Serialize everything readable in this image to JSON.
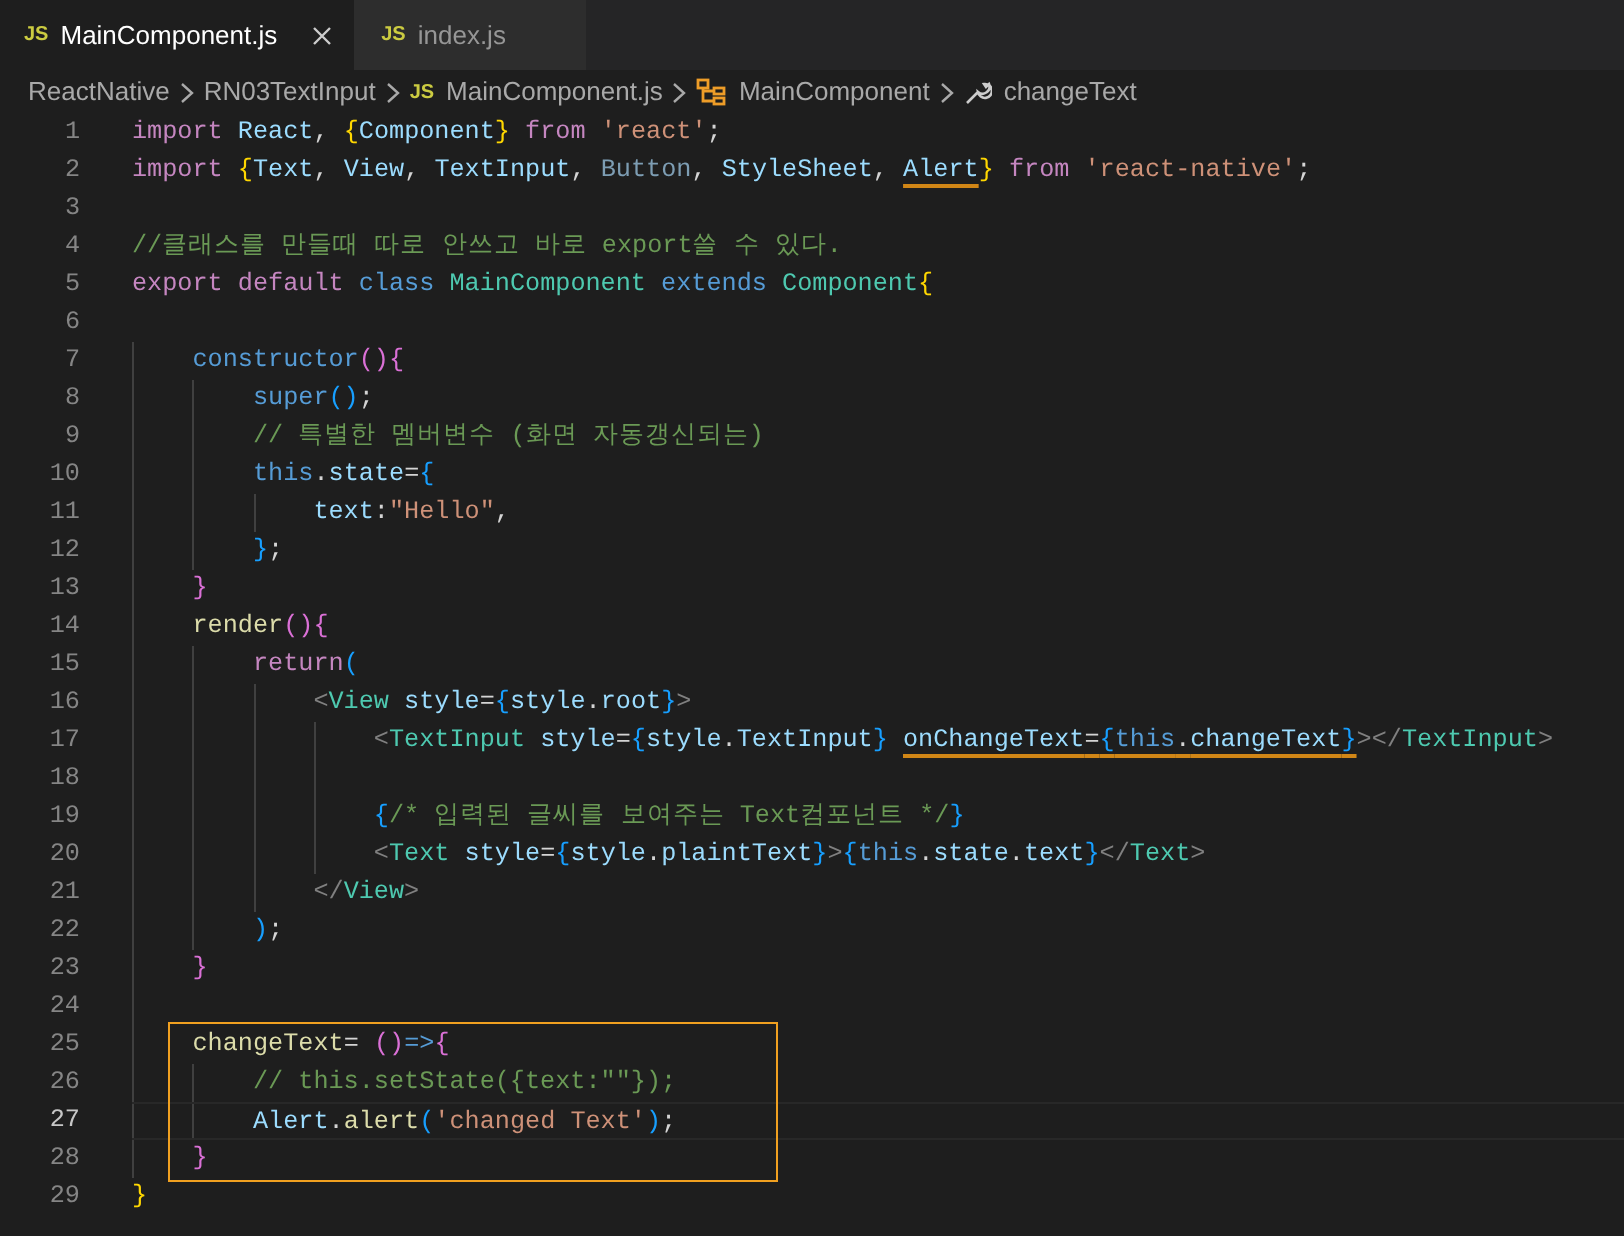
{
  "tabs": [
    {
      "badge": "JS",
      "label": "MainComponent.js",
      "selected": true
    },
    {
      "badge": "JS",
      "label": "index.js",
      "selected": false
    }
  ],
  "breadcrumb": [
    {
      "kind": "folder",
      "label": "ReactNative"
    },
    {
      "kind": "folder",
      "label": "RN03TextInput"
    },
    {
      "kind": "file",
      "badge": "JS",
      "label": "MainComponent.js"
    },
    {
      "kind": "class",
      "label": "MainComponent"
    },
    {
      "kind": "method",
      "label": "changeText"
    }
  ],
  "lines": [
    {
      "number": "1",
      "current": false,
      "boxed": false,
      "tokens": [
        {
          "kind": "kw",
          "t": "import "
        },
        {
          "kind": "var",
          "t": "React"
        },
        {
          "kind": "p",
          "t": ", "
        },
        {
          "kind": "b1",
          "t": "{"
        },
        {
          "kind": "var",
          "t": "Component"
        },
        {
          "kind": "b1",
          "t": "}"
        },
        {
          "kind": "kw",
          "t": " from "
        },
        {
          "kind": "str",
          "t": "'react'"
        },
        {
          "kind": "p",
          "t": ";"
        }
      ]
    },
    {
      "number": "2",
      "current": false,
      "boxed": false,
      "tokens": [
        {
          "kind": "kw",
          "t": "import "
        },
        {
          "kind": "b1",
          "t": "{"
        },
        {
          "kind": "var",
          "t": "Text"
        },
        {
          "kind": "p",
          "t": ", "
        },
        {
          "kind": "var",
          "t": "View"
        },
        {
          "kind": "p",
          "t": ", "
        },
        {
          "kind": "var",
          "t": "TextInput"
        },
        {
          "kind": "p",
          "t": ", "
        },
        {
          "kind": "unused",
          "t": "Button"
        },
        {
          "kind": "p",
          "t": ", "
        },
        {
          "kind": "var",
          "t": "StyleSheet"
        },
        {
          "kind": "p",
          "t": ", "
        },
        {
          "kind": "var_u",
          "t": "Alert"
        },
        {
          "kind": "b1",
          "t": "}"
        },
        {
          "kind": "kw",
          "t": " from "
        },
        {
          "kind": "str",
          "t": "'react-native'"
        },
        {
          "kind": "p",
          "t": ";"
        }
      ]
    },
    {
      "number": "3",
      "current": false,
      "boxed": false
    },
    {
      "number": "4",
      "current": false,
      "boxed": false,
      "tokens": [
        {
          "kind": "com",
          "t": "//클래스를 만들때 따로 안쓰고 바로 export쓸 수 있다."
        }
      ]
    },
    {
      "number": "5",
      "current": false,
      "boxed": false,
      "tokens": [
        {
          "kind": "kw",
          "t": "export default "
        },
        {
          "kind": "sto",
          "t": "class "
        },
        {
          "kind": "cls",
          "t": "MainComponent "
        },
        {
          "kind": "sto",
          "t": "extends "
        },
        {
          "kind": "cls",
          "t": "Component"
        },
        {
          "kind": "b1",
          "t": "{"
        }
      ]
    },
    {
      "number": "6",
      "current": false,
      "boxed": false
    },
    {
      "number": "7",
      "current": false,
      "boxed": false,
      "tokens": [
        {
          "kind": "sto",
          "t": "    constructor"
        },
        {
          "kind": "b2",
          "t": "(){"
        }
      ]
    },
    {
      "number": "8",
      "current": false,
      "boxed": false,
      "tokens": [
        {
          "kind": "sto",
          "t": "        super"
        },
        {
          "kind": "b3",
          "t": "()"
        },
        {
          "kind": "p",
          "t": ";"
        }
      ]
    },
    {
      "number": "9",
      "current": false,
      "boxed": false,
      "tokens": [
        {
          "kind": "com",
          "t": "        // 특별한 멤버변수 (화면 자동갱신되는)"
        }
      ]
    },
    {
      "number": "10",
      "current": false,
      "boxed": false,
      "tokens": [
        {
          "kind": "sto",
          "t": "        this"
        },
        {
          "kind": "p",
          "t": "."
        },
        {
          "kind": "var",
          "t": "state"
        },
        {
          "kind": "p",
          "t": "="
        },
        {
          "kind": "b3",
          "t": "{"
        }
      ]
    },
    {
      "number": "11",
      "current": false,
      "boxed": false,
      "tokens": [
        {
          "kind": "var",
          "t": "            text"
        },
        {
          "kind": "p",
          "t": ":"
        },
        {
          "kind": "str",
          "t": "\"Hello\""
        },
        {
          "kind": "p",
          "t": ","
        }
      ]
    },
    {
      "number": "12",
      "current": false,
      "boxed": false,
      "tokens": [
        {
          "kind": "b3",
          "t": "        }"
        },
        {
          "kind": "p",
          "t": ";"
        }
      ]
    },
    {
      "number": "13",
      "current": false,
      "boxed": false,
      "tokens": [
        {
          "kind": "b2",
          "t": "    }"
        }
      ]
    },
    {
      "number": "14",
      "current": false,
      "boxed": false,
      "tokens": [
        {
          "kind": "fn",
          "t": "    render"
        },
        {
          "kind": "b2",
          "t": "(){"
        }
      ]
    },
    {
      "number": "15",
      "current": false,
      "boxed": false,
      "tokens": [
        {
          "kind": "kw",
          "t": "        return"
        },
        {
          "kind": "b3",
          "t": "("
        }
      ]
    },
    {
      "number": "16",
      "current": false,
      "boxed": false,
      "tokens": [
        {
          "kind": "tag",
          "t": "            <"
        },
        {
          "kind": "cls",
          "t": "View "
        },
        {
          "kind": "var",
          "t": "style"
        },
        {
          "kind": "p",
          "t": "="
        },
        {
          "kind": "b3",
          "t": "{"
        },
        {
          "kind": "var",
          "t": "style"
        },
        {
          "kind": "p",
          "t": "."
        },
        {
          "kind": "var",
          "t": "root"
        },
        {
          "kind": "b3",
          "t": "}"
        },
        {
          "kind": "tag",
          "t": ">"
        }
      ]
    },
    {
      "number": "17",
      "current": false,
      "boxed": false,
      "tokens": [
        {
          "kind": "tag",
          "t": "                <"
        },
        {
          "kind": "cls",
          "t": "TextInput "
        },
        {
          "kind": "var",
          "t": "style"
        },
        {
          "kind": "p",
          "t": "="
        },
        {
          "kind": "b3",
          "t": "{"
        },
        {
          "kind": "var",
          "t": "style"
        },
        {
          "kind": "p",
          "t": "."
        },
        {
          "kind": "var",
          "t": "TextInput"
        },
        {
          "kind": "b3",
          "t": "} "
        },
        {
          "kind": "var_u",
          "t": "onChangeText"
        },
        {
          "kind": "p_u",
          "t": "="
        },
        {
          "kind": "b3_u",
          "t": "{"
        },
        {
          "kind": "sto_u",
          "t": "this"
        },
        {
          "kind": "p_u",
          "t": "."
        },
        {
          "kind": "var_u",
          "t": "changeText"
        },
        {
          "kind": "b3_u",
          "t": "}"
        },
        {
          "kind": "tag",
          "t": "></"
        },
        {
          "kind": "cls",
          "t": "TextInput"
        },
        {
          "kind": "tag",
          "t": ">"
        }
      ]
    },
    {
      "number": "18",
      "current": false,
      "boxed": false
    },
    {
      "number": "19",
      "current": false,
      "boxed": false,
      "tokens": [
        {
          "kind": "b3",
          "t": "                {"
        },
        {
          "kind": "com",
          "t": "/* 입력된 글씨를 보여주는 Text컴포넌트 */"
        },
        {
          "kind": "b3",
          "t": "}"
        }
      ]
    },
    {
      "number": "20",
      "current": false,
      "boxed": false,
      "tokens": [
        {
          "kind": "tag",
          "t": "                <"
        },
        {
          "kind": "cls",
          "t": "Text "
        },
        {
          "kind": "var",
          "t": "style"
        },
        {
          "kind": "p",
          "t": "="
        },
        {
          "kind": "b3",
          "t": "{"
        },
        {
          "kind": "var",
          "t": "style"
        },
        {
          "kind": "p",
          "t": "."
        },
        {
          "kind": "var",
          "t": "plaintText"
        },
        {
          "kind": "b3",
          "t": "}"
        },
        {
          "kind": "tag",
          "t": ">"
        },
        {
          "kind": "b3",
          "t": "{"
        },
        {
          "kind": "sto",
          "t": "this"
        },
        {
          "kind": "p",
          "t": "."
        },
        {
          "kind": "var",
          "t": "state"
        },
        {
          "kind": "p",
          "t": "."
        },
        {
          "kind": "var",
          "t": "text"
        },
        {
          "kind": "b3",
          "t": "}"
        },
        {
          "kind": "tag",
          "t": "</"
        },
        {
          "kind": "cls",
          "t": "Text"
        },
        {
          "kind": "tag",
          "t": ">"
        }
      ]
    },
    {
      "number": "21",
      "current": false,
      "boxed": false,
      "tokens": [
        {
          "kind": "tag",
          "t": "            </"
        },
        {
          "kind": "cls",
          "t": "View"
        },
        {
          "kind": "tag",
          "t": ">"
        }
      ]
    },
    {
      "number": "22",
      "current": false,
      "boxed": false,
      "tokens": [
        {
          "kind": "b3",
          "t": "        )"
        },
        {
          "kind": "p",
          "t": ";"
        }
      ]
    },
    {
      "number": "23",
      "current": false,
      "boxed": false,
      "tokens": [
        {
          "kind": "b2",
          "t": "    }"
        }
      ]
    },
    {
      "number": "24",
      "current": false,
      "boxed": false
    },
    {
      "number": "25",
      "current": false,
      "boxed": true,
      "tokens": [
        {
          "kind": "fn",
          "t": "    changeText"
        },
        {
          "kind": "p",
          "t": "= "
        },
        {
          "kind": "b2",
          "t": "()"
        },
        {
          "kind": "sto",
          "t": "=>"
        },
        {
          "kind": "b2",
          "t": "{"
        }
      ]
    },
    {
      "number": "26",
      "current": false,
      "boxed": true,
      "tokens": [
        {
          "kind": "com",
          "t": "        // this.setState({text:\"\"});"
        }
      ]
    },
    {
      "number": "27",
      "current": true,
      "boxed": true,
      "tokens": [
        {
          "kind": "var",
          "t": "        Alert"
        },
        {
          "kind": "p",
          "t": "."
        },
        {
          "kind": "fn",
          "t": "alert"
        },
        {
          "kind": "b3",
          "t": "("
        },
        {
          "kind": "str",
          "t": "'changed Text'"
        },
        {
          "kind": "b3",
          "t": ")"
        },
        {
          "kind": "p",
          "t": ";"
        }
      ]
    },
    {
      "number": "28",
      "current": false,
      "boxed": true,
      "tokens": [
        {
          "kind": "b2",
          "t": "    }"
        }
      ]
    },
    {
      "number": "29",
      "current": false,
      "boxed": false,
      "tokens": [
        {
          "kind": "b1",
          "t": "}"
        }
      ]
    }
  ]
}
